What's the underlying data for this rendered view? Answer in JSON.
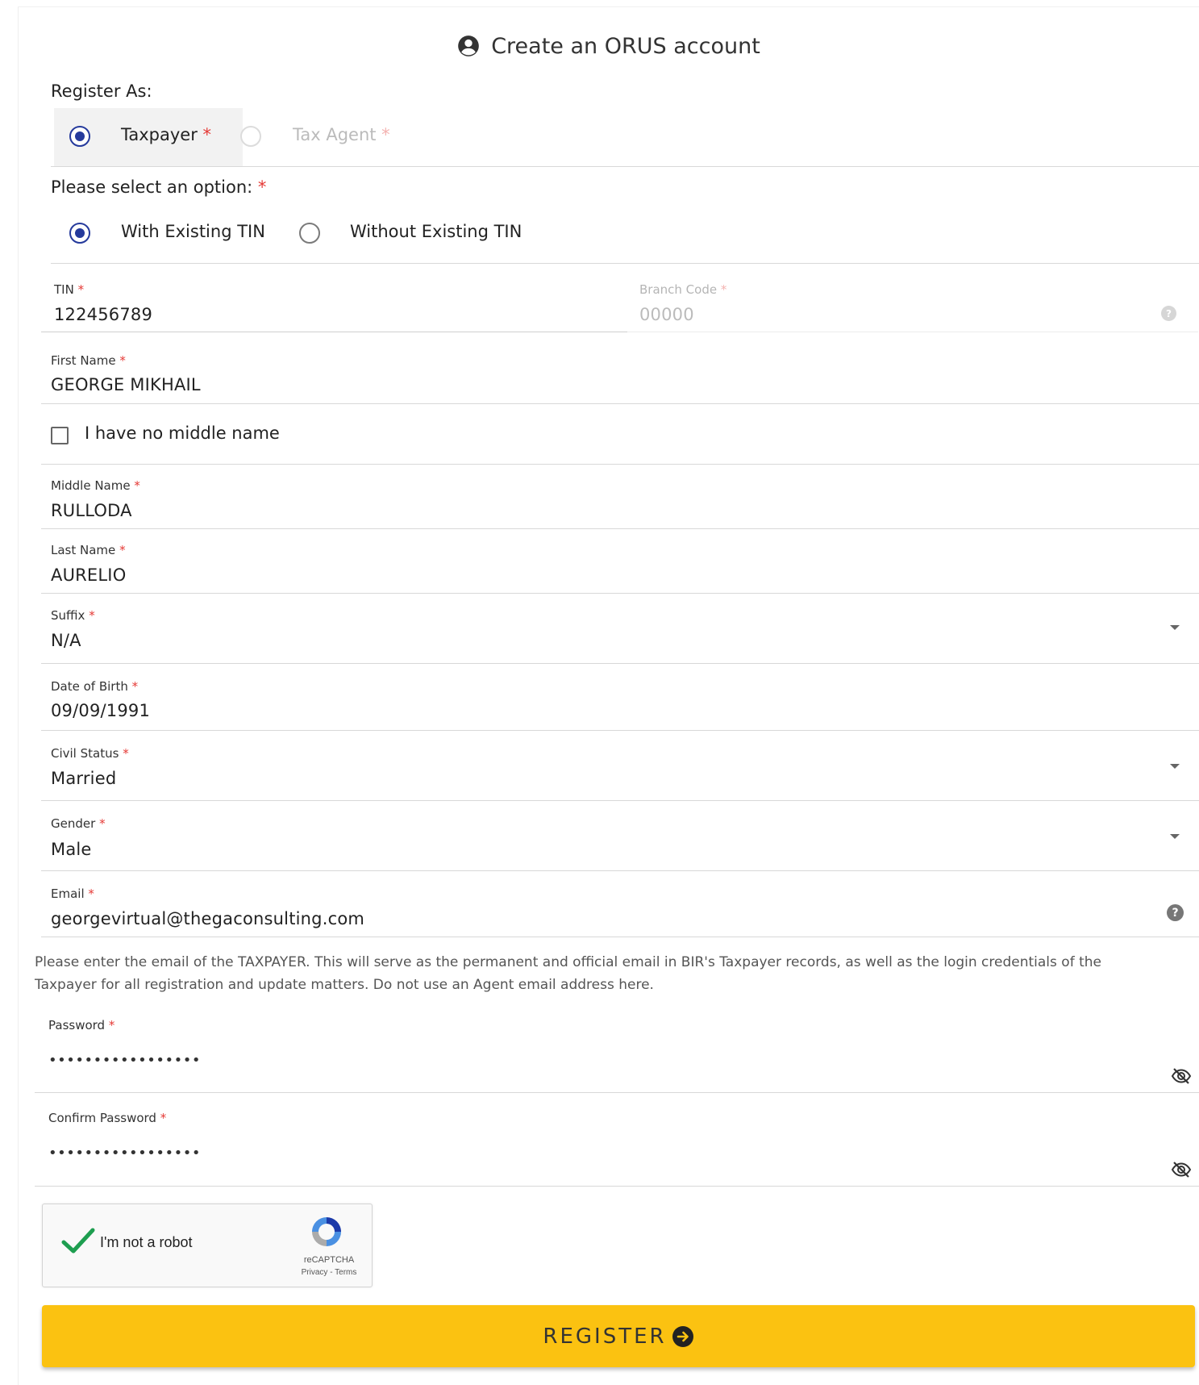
{
  "title": "Create an ORUS account",
  "register_as": {
    "label": "Register As:",
    "options": [
      {
        "label": "Taxpayer",
        "required": "*",
        "checked": true
      },
      {
        "label": "Tax Agent",
        "required": "*",
        "checked": false,
        "disabled": true
      }
    ]
  },
  "select_option": {
    "label": "Please select an option:",
    "required": "*",
    "options": [
      {
        "label": "With Existing TIN",
        "checked": true
      },
      {
        "label": "Without Existing TIN",
        "checked": false
      }
    ]
  },
  "fields": {
    "tin": {
      "label": "TIN",
      "value": "122456789"
    },
    "branch_code": {
      "label": "Branch Code",
      "placeholder": "00000"
    },
    "first_name": {
      "label": "First Name",
      "value": "GEORGE MIKHAIL"
    },
    "no_middle_name": {
      "label": "I have no middle name",
      "checked": false
    },
    "middle_name": {
      "label": "Middle Name",
      "value": "RULLODA"
    },
    "last_name": {
      "label": "Last Name",
      "value": "AURELIO"
    },
    "suffix": {
      "label": "Suffix",
      "value": "N/A"
    },
    "dob": {
      "label": "Date of Birth",
      "value": "09/09/1991"
    },
    "civil_status": {
      "label": "Civil Status",
      "value": "Married"
    },
    "gender": {
      "label": "Gender",
      "value": "Male"
    },
    "email": {
      "label": "Email",
      "value": "georgevirtual@thegaconsulting.com"
    },
    "password": {
      "label": "Password",
      "value": "•••••••••••••••••"
    },
    "confirm_password": {
      "label": "Confirm Password",
      "value": "•••••••••••••••••"
    }
  },
  "required_mark": "*",
  "email_note": "Please enter the email of the TAXPAYER. This will serve as the permanent and official email in BIR's Taxpayer records, as well as the login credentials of the Taxpayer for all registration and update matters. Do not use an Agent email address here.",
  "captcha": {
    "label": "I'm not a robot",
    "brand": "reCAPTCHA",
    "terms": "Privacy - Terms",
    "checked": true
  },
  "register_button": "REGISTER",
  "colors": {
    "accent": "#253a9c",
    "button": "#fbc211",
    "required": "#e53935",
    "check": "#1e9e50"
  },
  "icons": {
    "title": "account-circle-icon",
    "help": "help-icon",
    "password_toggle": "eye-off-icon",
    "dropdown": "caret-down-icon",
    "register": "arrow-right-circle-icon"
  }
}
